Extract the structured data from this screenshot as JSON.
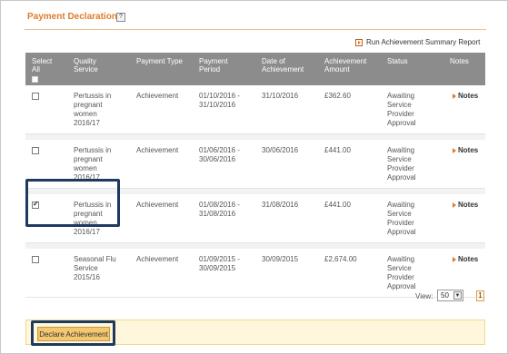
{
  "header": {
    "title": "Payment Declaration",
    "help": "?"
  },
  "toolbar": {
    "report_label": "Run Achievement Summary Report"
  },
  "table": {
    "columns": {
      "select_all": "Select All",
      "quality_service": "Quality Service",
      "payment_type": "Payment Type",
      "payment_period": "Payment Period",
      "date_of_achievement": "Date of Achievement",
      "achievement_amount": "Achievement Amount",
      "status": "Status",
      "notes": "Notes"
    },
    "rows": [
      {
        "checked": false,
        "service": "Pertussis in pregnant women 2016/17",
        "type": "Achievement",
        "period": "01/10/2016 - 31/10/2016",
        "date": "31/10/2016",
        "amount": "£362.60",
        "status": "Awaiting Service Provider Approval",
        "notes": "Notes"
      },
      {
        "checked": false,
        "service": "Pertussis in pregnant women 2016/17",
        "type": "Achievement",
        "period": "01/06/2016 - 30/06/2016",
        "date": "30/06/2016",
        "amount": "£441.00",
        "status": "Awaiting Service Provider Approval",
        "notes": "Notes"
      },
      {
        "checked": true,
        "service": "Pertussis in pregnant women 2016/17",
        "type": "Achievement",
        "period": "01/08/2016 - 31/08/2016",
        "date": "31/08/2016",
        "amount": "£441.00",
        "status": "Awaiting Service Provider Approval",
        "notes": "Notes"
      },
      {
        "checked": false,
        "service": "Seasonal Flu Service 2015/16",
        "type": "Achievement",
        "period": "01/09/2015 - 30/09/2015",
        "date": "30/09/2015",
        "amount": "£2,674.00",
        "status": "Awaiting Service Provider Approval",
        "notes": "Notes"
      }
    ]
  },
  "pagination": {
    "view_label": "View:",
    "view_value": "50",
    "page": "1"
  },
  "footer": {
    "declare_label": "Declare Achievement"
  },
  "colors": {
    "accent": "#e07b2a",
    "header_bg": "#8c8c8c",
    "highlight": "#1e3a5f"
  }
}
